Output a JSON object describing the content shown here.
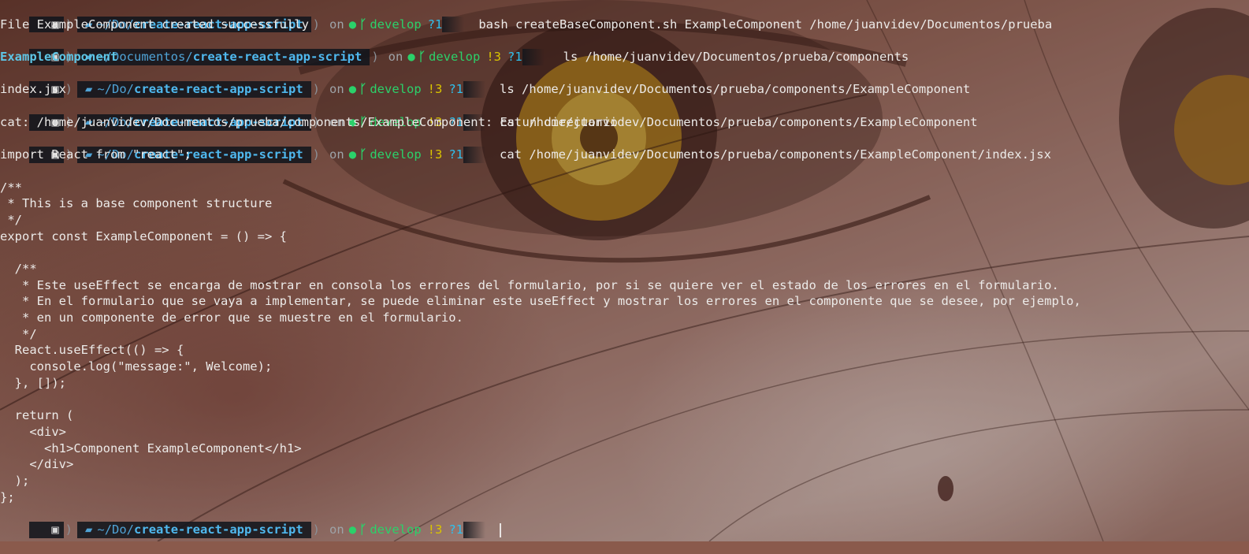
{
  "colors": {
    "path": "#4fb8ee",
    "git": "#2bd16a",
    "status": "#d9c400",
    "untracked": "#2ec0ee",
    "directory": "#5ec6e6"
  },
  "prompts": [
    {
      "path_prefix": "~/Do/",
      "path_main": "create-react-app-script",
      "on": "on",
      "branch": "develop",
      "status": "",
      "untracked": "?1",
      "command": "bash createBaseComponent.sh ExampleComponent /home/juanvidev/Documentos/prueba"
    },
    {
      "path_prefix": "~/Documentos/",
      "path_main": "create-react-app-script",
      "on": "on",
      "branch": "develop",
      "status": "!3",
      "untracked": "?1",
      "command": "ls /home/juanvidev/Documentos/prueba/components"
    },
    {
      "path_prefix": "~/Do/",
      "path_main": "create-react-app-script",
      "on": "on",
      "branch": "develop",
      "status": "!3",
      "untracked": "?1",
      "command": "ls /home/juanvidev/Documentos/prueba/components/ExampleComponent"
    },
    {
      "path_prefix": "~/Do/",
      "path_main": "create-react-app-script",
      "on": "on",
      "branch": "develop",
      "status": "!3",
      "untracked": "?1",
      "command": "cat /home/juanvidev/Documentos/prueba/components/ExampleComponent"
    },
    {
      "path_prefix": "~/Do/",
      "path_main": "create-react-app-script",
      "on": "on",
      "branch": "develop",
      "status": "!3",
      "untracked": "?1",
      "command": "cat /home/juanvidev/Documentos/prueba/components/ExampleComponent/index.jsx"
    },
    {
      "path_prefix": "~/Do/",
      "path_main": "create-react-app-script",
      "on": "on",
      "branch": "develop",
      "status": "!3",
      "untracked": "?1",
      "command": ""
    }
  ],
  "outputs": {
    "created": "File ExampleComponent created successfully",
    "ls_components": "ExampleComponent",
    "ls_component_dir": "index.jsx",
    "cat_error": "cat: /home/juanvidev/Documentos/prueba/components/ExampleComponent: Es un directorio",
    "file_lines": [
      "import React from \"react\";",
      "",
      "/**",
      " * This is a base component structure",
      " */",
      "export const ExampleComponent = () => {",
      "",
      "  /**",
      "   * Este useEffect se encarga de mostrar en consola los errores del formulario, por si se quiere ver el estado de los errores en el formulario.",
      "   * En el formulario que se vaya a implementar, se puede eliminar este useEffect y mostrar los errores en el componente que se desee, por ejemplo,",
      "   * en un componente de error que se muestre en el formulario.",
      "   */",
      "  React.useEffect(() => {",
      "    console.log(\"message:\", Welcome);",
      "  }, []);",
      "",
      "  return (",
      "    <div>",
      "      <h1>Component ExampleComponent</h1>",
      "    </div>",
      "  );",
      "};"
    ]
  },
  "icons": {
    "os": "os-logo-icon",
    "folder": "folder-icon",
    "github": "github-icon",
    "branch": "git-branch-icon"
  }
}
